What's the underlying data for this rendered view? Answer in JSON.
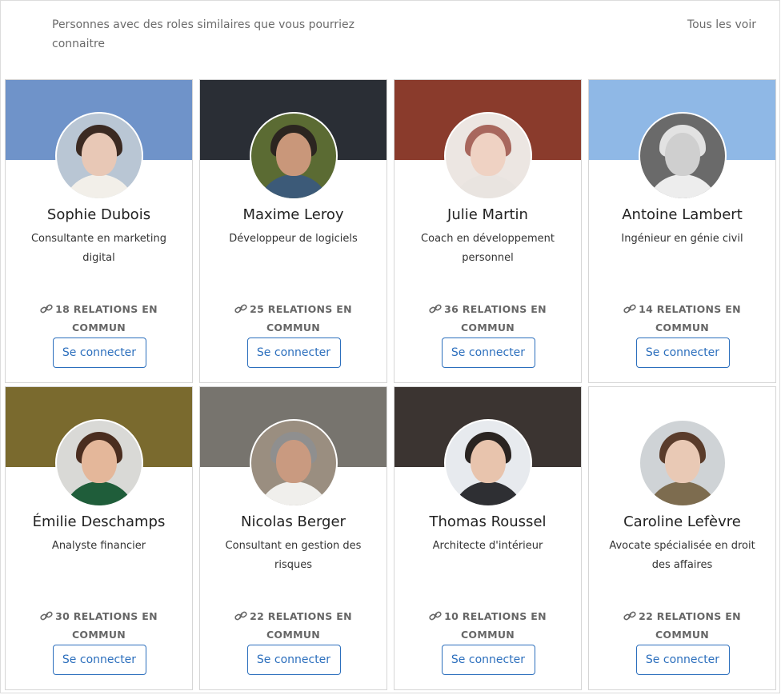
{
  "header": {
    "title": "Personnes avec des roles similaires que vous pourriez connaitre",
    "see_all": "Tous les voir"
  },
  "cards": [
    {
      "name": "Sophie Dubois",
      "title": "Consultante en marketing digital",
      "mutual": "18 RELATIONS EN COMMUN",
      "connect": "Se connecter",
      "banner": "#6f93c9",
      "avatar_bg": "#b9c6d4",
      "skin": "#e8c8b6",
      "hair": "#3b2a22",
      "shirt": "#f2efe9"
    },
    {
      "name": "Maxime Leroy",
      "title": "Développeur de logiciels",
      "mutual": "25 RELATIONS EN COMMUN",
      "connect": "Se connecter",
      "banner": "#2a2e35",
      "avatar_bg": "#5b6b33",
      "skin": "#c9977a",
      "hair": "#2b2520",
      "shirt": "#3c5a78"
    },
    {
      "name": "Julie Martin",
      "title": "Coach en développement personnel",
      "mutual": "36 RELATIONS EN COMMUN",
      "connect": "Se connecter",
      "banner": "#8a3b2c",
      "avatar_bg": "#ece6e2",
      "skin": "#efd2c3",
      "hair": "#a8675d",
      "shirt": "#e9e4e0"
    },
    {
      "name": "Antoine Lambert",
      "title": "Ingénieur en génie civil",
      "mutual": "14 RELATIONS EN COMMUN",
      "connect": "Se connecter",
      "banner": "#8fb8e6",
      "avatar_bg": "#6a6a6a",
      "skin": "#cfcfcf",
      "hair": "#e2e2e2",
      "shirt": "#ededed"
    },
    {
      "name": "Émilie Deschamps",
      "title": "Analyste financier",
      "mutual": "30 RELATIONS EN COMMUN",
      "connect": "Se connecter",
      "banner": "#7a6a2e",
      "avatar_bg": "#d9d9d6",
      "skin": "#e4b79a",
      "hair": "#4a2d1f",
      "shirt": "#1f5d3a"
    },
    {
      "name": "Nicolas Berger",
      "title": "Consultant en gestion des risques",
      "mutual": "22 RELATIONS EN COMMUN",
      "connect": "Se connecter",
      "banner": "#77746e",
      "avatar_bg": "#9a8e80",
      "skin": "#c99a80",
      "hair": "#8f8f8f",
      "shirt": "#f0efec"
    },
    {
      "name": "Thomas Roussel",
      "title": "Architecte d'intérieur",
      "mutual": "10 RELATIONS EN COMMUN",
      "connect": "Se connecter",
      "banner": "#3b3431",
      "avatar_bg": "#e7eaee",
      "skin": "#e8c4ad",
      "hair": "#2a2421",
      "shirt": "#2e2f33"
    },
    {
      "name": "Caroline Lefèvre",
      "title": "Avocate spécialisée en droit des affaires",
      "mutual": "22 RELATIONS EN COMMUN",
      "connect": "Se connecter",
      "banner": "#ffffff",
      "avatar_bg": "#cfd3d6",
      "skin": "#e9c9b5",
      "hair": "#5a3c2b",
      "shirt": "#7d6c4f"
    }
  ]
}
